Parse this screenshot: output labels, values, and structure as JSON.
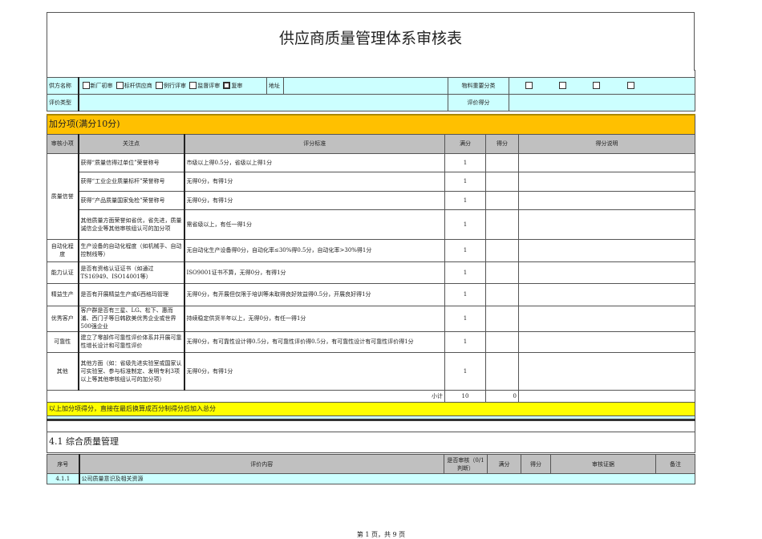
{
  "title": "供应商质量管理体系审核表",
  "info": {
    "supplier_label": "供方名称",
    "options": [
      "新厂初审",
      "标杆供应商",
      "例行评审",
      "监督评审",
      "复审"
    ],
    "address_label": "地址",
    "material_label": "物料重要分类",
    "eval_type_label": "评价类型",
    "eval_score_label": "评价得分"
  },
  "bonus": {
    "heading": "加分项(满分10分)",
    "headers": [
      "审核小项",
      "关注点",
      "评分标准",
      "满分",
      "得分",
      "得分说明"
    ],
    "rows": [
      {
        "item": "质量信誉",
        "focus": "获得“质量信得过单位”荣誉称号",
        "criteria": "市级以上得0.5分，省级以上得1分",
        "full": "1"
      },
      {
        "focus": "获得“工业企业质量标杆”荣誉称号",
        "criteria": "无得0分，有得1分",
        "full": "1"
      },
      {
        "focus": "获得“产品质量国家免检”荣誉称号",
        "criteria": "无得0分，有得1分",
        "full": "1"
      },
      {
        "focus": "其他质量方面荣誉如省优，省先进，质量诚信企业等其他审核组认可的加分项",
        "criteria": "需省级以上，有任一得1分",
        "full": "1"
      },
      {
        "item": "自动化程度",
        "focus": "生产设备的自动化程度（如机械手、自动控制线等）",
        "criteria": "无自动化生产设备得0分，自动化率≤30%得0.5分，自动化率>30%得1分",
        "full": "1"
      },
      {
        "item": "能力认证",
        "focus": "是否有资格认证证书（如通过TS16949、ISO14001等）",
        "criteria": "ISO9001证书不算，无得0分，有得1分",
        "full": "1"
      },
      {
        "item": "精益生产",
        "focus": "是否有开展精益生产或6西格玛管理",
        "criteria": "无得0分，有开展但仅限于培训等未取得良好效益得0.5分，开展良好得1分",
        "full": "1"
      },
      {
        "item": "优秀客户",
        "focus": "客户群是否有三星、LG、松下、惠而浦、西门子等日韩欧美优秀企业或世界500强企业",
        "criteria": "持续稳定供货半年以上，无得0分，有任一得1分",
        "full": "1"
      },
      {
        "item": "可靠性",
        "focus": "建立了零部件可靠性评价体系并开展可靠性增长设计和可靠性评价",
        "criteria": "无得0分，有可靠性设计得0.5分，有可靠性评价得0.5分，有可靠性设计有可靠性评价得1分",
        "full": "1"
      },
      {
        "item": "其他",
        "focus": "其他方面（如：省级先进实验室或国家认可实验室、参与标准制定、发明专利3项以上等其他审核组认可的加分项）",
        "criteria": "无得0分，有得1分",
        "full": "1"
      }
    ],
    "subtotal_label": "小计",
    "subtotal_full": "10",
    "subtotal_score": "0",
    "note": "以上加分项得分，直接在最后换算成百分制得分后加入总分"
  },
  "section": {
    "heading": "4.1 综合质量管理",
    "headers": [
      "序号",
      "评价内容",
      "是否审核（0/1判断）",
      "满分",
      "得分",
      "审核证据",
      "备注"
    ],
    "row": {
      "no": "4.1.1",
      "content": "公司质量意识及相关资源"
    }
  },
  "footer": "第 1 页，共 9 页"
}
